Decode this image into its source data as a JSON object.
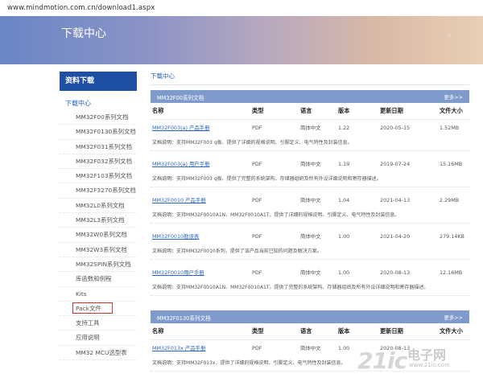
{
  "url": "www.mindmotion.com.cn/download1.aspx",
  "banner": {
    "title": "下载中心"
  },
  "sidebar": {
    "header": "资料下载",
    "category": "下载中心",
    "items": [
      "MM32F00系列文档",
      "MM32F0130系列文档",
      "MM32F031系列文档",
      "MM32F032系列文档",
      "MM32F103系列文档",
      "MM32F3270系列文档",
      "MM32L0系列文档",
      "MM32L3系列文档",
      "MM32W0系列文档",
      "MM32W3系列文档",
      "MM32SPIN系列文档",
      "库函数和例程",
      "Kits",
      "Pack文件",
      "支持工具",
      "应用说明",
      "MM32 MCU选型表"
    ],
    "highlighted_item": "Pack文件"
  },
  "main": {
    "breadcrumb": "下载中心",
    "columns": [
      "名称",
      "类型",
      "语言",
      "版本",
      "更新日期",
      "文件大小"
    ],
    "desc_label": "文档说明：",
    "sections": [
      {
        "title": "MM32F00系列文档",
        "more": "更多>>",
        "docs": [
          {
            "name": "MM32F003(a) 产品手册",
            "type": "PDF",
            "lang": "简体中文",
            "version": "1.22",
            "date": "2020-05-15",
            "size": "1.52MB",
            "desc": "支持MM32F003 q板、提供了详细的规格说明、引脚定义、电气特性及封装信息。"
          },
          {
            "name": "MM32F003(a) 用户手册",
            "type": "PDF",
            "lang": "简体中文",
            "version": "1.19",
            "date": "2019-07-24",
            "size": "15.16MB",
            "desc": "支持MM32F003 q板、提供了完整的系统架构、存储器组织及所有外设详细说明和寄存器描述。"
          },
          {
            "name": "MM32F0010 产品手册",
            "type": "PDF",
            "lang": "简体中文",
            "version": "1.04",
            "date": "2021-04-13",
            "size": "2.29MB",
            "desc": "支持MM32F0010A1N、MM32F0010A1T，提供了详细的规格说明、引脚定义、电气特性及封装信息。"
          },
          {
            "name": "MM32F0010勘误表",
            "type": "PDF",
            "lang": "简体中文",
            "version": "1.00",
            "date": "2021-04-20",
            "size": "279.14KB",
            "desc": "支持MM32F0010系列，提供了该产品当前已知的问题及解决方案。"
          },
          {
            "name": "MM32F0010用户手册",
            "type": "PDF",
            "lang": "简体中文",
            "version": "1.00",
            "date": "2020-08-13",
            "size": "12.16MB",
            "desc": "支持MM32F0010A1N、MM32F0010A1T，提供了完整的系统架构、存储器组织及所有外设详细说明和寄存器描述。"
          }
        ]
      },
      {
        "title": "MM32F0130系列文档",
        "more": "更多>>",
        "docs": [
          {
            "name": "MM32F013x 产品手册",
            "type": "PDF",
            "lang": "简体中文",
            "version": "1.00",
            "date": "2020-08-13",
            "size": "",
            "desc": "支持MM32F013x，提供了详细的规格说明、引脚定义、电气特性及封装信息。"
          }
        ]
      }
    ]
  },
  "watermark": {
    "logo": "21ic",
    "sub": "电子网",
    "url": "www.21ic.com"
  },
  "colors": {
    "sidebar_header": "#1f4fa3",
    "section_header": "#7f9bcc",
    "link": "#2a66c6",
    "highlight_border": "#c0392b"
  }
}
